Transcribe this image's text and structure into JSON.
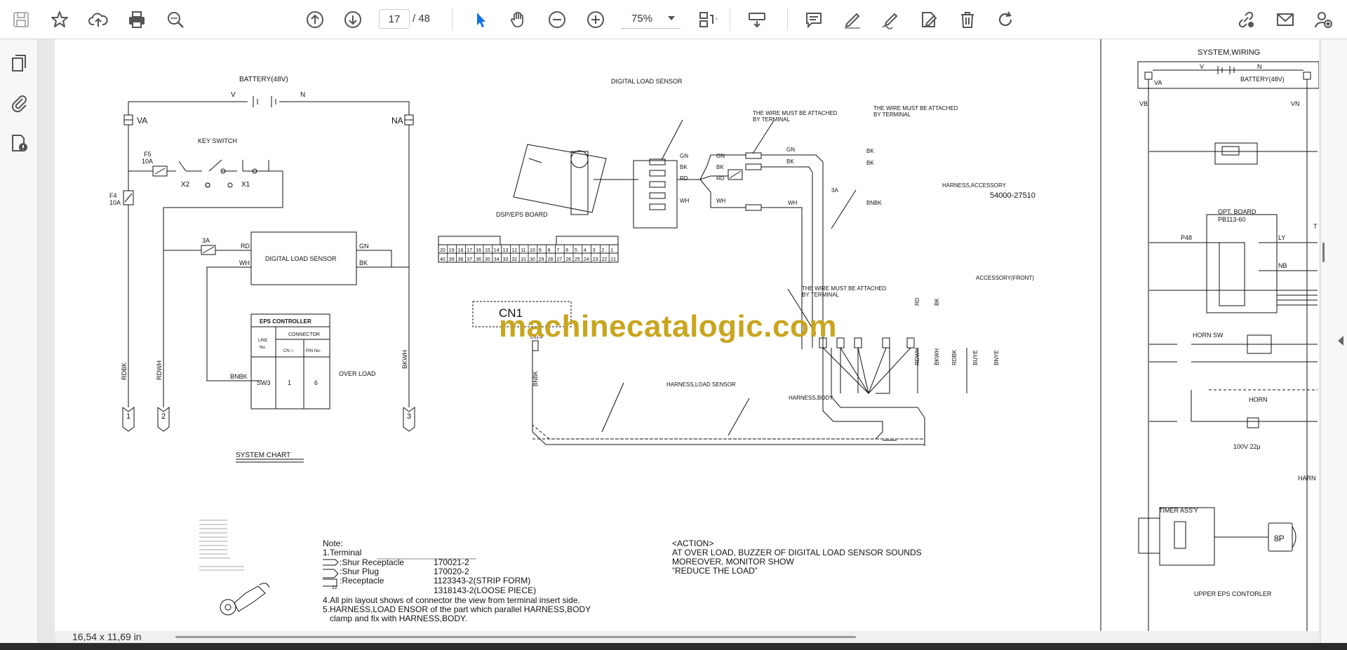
{
  "toolbar": {
    "page_current": "17",
    "page_total": "/ 48",
    "zoom": "75%"
  },
  "status": {
    "page_size": "16,54 x 11,69 in"
  },
  "watermark": "machinecatalogic.com",
  "drawing": {
    "battery": "BATTERY(48V)",
    "v": "V",
    "n": "N",
    "va": "VA",
    "na": "NA",
    "key_switch": "KEY SWITCH",
    "f5": "F5",
    "f5_amp": "10A",
    "f4": "F4",
    "f4_amp": "10A",
    "x2": "X2",
    "x1": "X1",
    "fuse_3a": "3A",
    "rd": "RD",
    "wh": "WH",
    "gn": "GN",
    "bk": "BK",
    "bnbk": "BNBK",
    "dls_box": "DIGITAL LOAD SENSOR",
    "eps_controller": "EPS CONTROLLER",
    "connector": "CONNECTOR",
    "line_no_1": "LINE",
    "line_no_2": "No.",
    "cn_label": "CN □",
    "pin_no_1": "PIN",
    "pin_no_2": "No.",
    "sw3": "SW3",
    "val_1": "1",
    "val_6": "6",
    "over_load": "OVER LOAD",
    "rdbk": "RDBK",
    "rdwh": "RDWH",
    "bkwh": "BKWH",
    "term_1": "1",
    "term_2": "2",
    "term_3": "3",
    "system_chart": "SYSTEM CHART",
    "dls_title": "DIGITAL LOAD SENSOR",
    "dsp_board": "DSP/EPS BOARD",
    "pins_top": [
      "20",
      "19",
      "18",
      "17",
      "16",
      "15",
      "14",
      "13",
      "12",
      "11",
      "10",
      "9",
      "8",
      "7",
      "6",
      "5",
      "4",
      "3",
      "2",
      "1"
    ],
    "pins_bottom": [
      "40",
      "39",
      "38",
      "37",
      "36",
      "35",
      "34",
      "33",
      "32",
      "31",
      "30",
      "29",
      "28",
      "27",
      "26",
      "25",
      "24",
      "23",
      "22",
      "21"
    ],
    "cn1": "CN1",
    "cn1_4": "CN1-4",
    "wire_attach_1a": "THE WIRE MUST BE ATTACHED",
    "wire_attach_1b": "BY TERMINAL",
    "wire_attach_2a": "THE WIRE MUST BE ATTACHED",
    "wire_attach_2b": "BY TERMINAL",
    "wire_attach_3a": "THE WIRE MUST BE ATTACHED",
    "wire_attach_3b": "BY TERMINAL",
    "harness_accessory": "HARNESS,ACCESSORY",
    "harness_accessory_no": "54000-27510",
    "accessory_front": "ACCESSORY(FRONT)",
    "harness_load_sensor": "HARNESS,LOAD SENSOR",
    "harness_body": "HARNESS,BODY",
    "bkwh2": "BKWH",
    "rdbk2": "RDBK",
    "buye": "BUYE",
    "bnye": "BNYE",
    "bk2": "BK",
    "rd2": "RD",
    "note_title": "Note:",
    "note_1": "1.Terminal",
    "note_shur_rec": ":Shur Receptacle",
    "note_shur_rec_no": "170021-2",
    "note_shur_plug": ":Shur Plug",
    "note_shur_plug_no": "170020-2",
    "note_rec": ":Receptacle",
    "note_rec_no1": "1123343-2(STRIP FORM)",
    "note_rec_no2": "1318143-2(LOOSE PIECE)",
    "note_4": "4.All pin layout shows of connector the view from terminal insert side.",
    "note_5a": "5.HARNESS,LOAD ENSOR of the part which parallel HARNESS,BODY",
    "note_5b": "clamp and fix with HARNESS,BODY.",
    "action_title": "<ACTION>",
    "action_1": "AT OVER LOAD, BUZZER OF DIGITAL LOAD SENSOR SOUNDS",
    "action_2": "MOREOVER, MONITOR SHOW",
    "action_3": "”REDUCE THE LOAD”",
    "sys_wiring": "SYSTEM,WIRING",
    "battery2": "BATTERY(48V)",
    "vb": "VB",
    "vn": "VN",
    "opt_board": "OPT. BOARD",
    "pb": "PB113-60",
    "p48": "P48",
    "ly": "LY",
    "nb": "NB",
    "horn_sw": "HORN SW",
    "horn": "HORN",
    "horn_v": "100V 22μ",
    "timer_assy": "TIMER ASS'Y",
    "eight_p": "8P",
    "upper_eps": "UPPER EPS CONTORLER",
    "harn_cut": "HARN",
    "t_cut": "T",
    "num_22": "22"
  }
}
